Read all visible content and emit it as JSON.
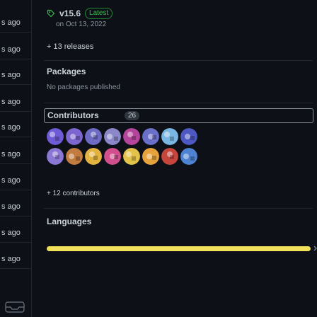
{
  "left_column": {
    "labels": [
      "s ago",
      "s ago",
      "s ago",
      "s ago",
      "s ago",
      "s ago",
      "s ago",
      "s ago",
      "s ago",
      "s ago"
    ]
  },
  "release": {
    "tag": "v15.6",
    "badge": "Latest",
    "date": "on Oct 13, 2022",
    "more_releases": "+ 13 releases"
  },
  "packages": {
    "heading": "Packages",
    "empty_text": "No packages published"
  },
  "contributors": {
    "heading": "Contributors",
    "count": "26",
    "more": "+ 12 contributors",
    "avatars": [
      {
        "icon": "purple-dot-avatar",
        "color": "#6f5bd6"
      },
      {
        "icon": "pinwheel-avatar",
        "color": "#7d66cf"
      },
      {
        "icon": "pattern-avatar",
        "color": "#6e6bc5"
      },
      {
        "icon": "small-dot-avatar",
        "color": "#8a88c9"
      },
      {
        "icon": "pink-pattern-avatar",
        "color": "#b5459b"
      },
      {
        "icon": "cartoon-avatar",
        "color": "#6a6fc9"
      },
      {
        "icon": "blocks-avatar",
        "color": "#7ab6e3"
      },
      {
        "icon": "outline-pattern-avatar",
        "color": "#4d58c1"
      },
      {
        "icon": "swirl-avatar",
        "color": "#8b78d5"
      },
      {
        "icon": "photo-avatar",
        "color": "#c27c3f"
      },
      {
        "icon": "brand-avatar",
        "color": "#e3b341"
      },
      {
        "icon": "pink-avatar",
        "color": "#d04f8c"
      },
      {
        "icon": "duck-avatar",
        "color": "#e3c24a"
      },
      {
        "icon": "shape-avatar",
        "color": "#e6a33b"
      },
      {
        "icon": "round-avatar",
        "color": "#c6453c"
      },
      {
        "icon": "person-avatar",
        "color": "#4d83d1"
      }
    ]
  },
  "languages": {
    "heading": "Languages",
    "bar_color": "#f1e05a",
    "bar_fraction": 1.0
  }
}
